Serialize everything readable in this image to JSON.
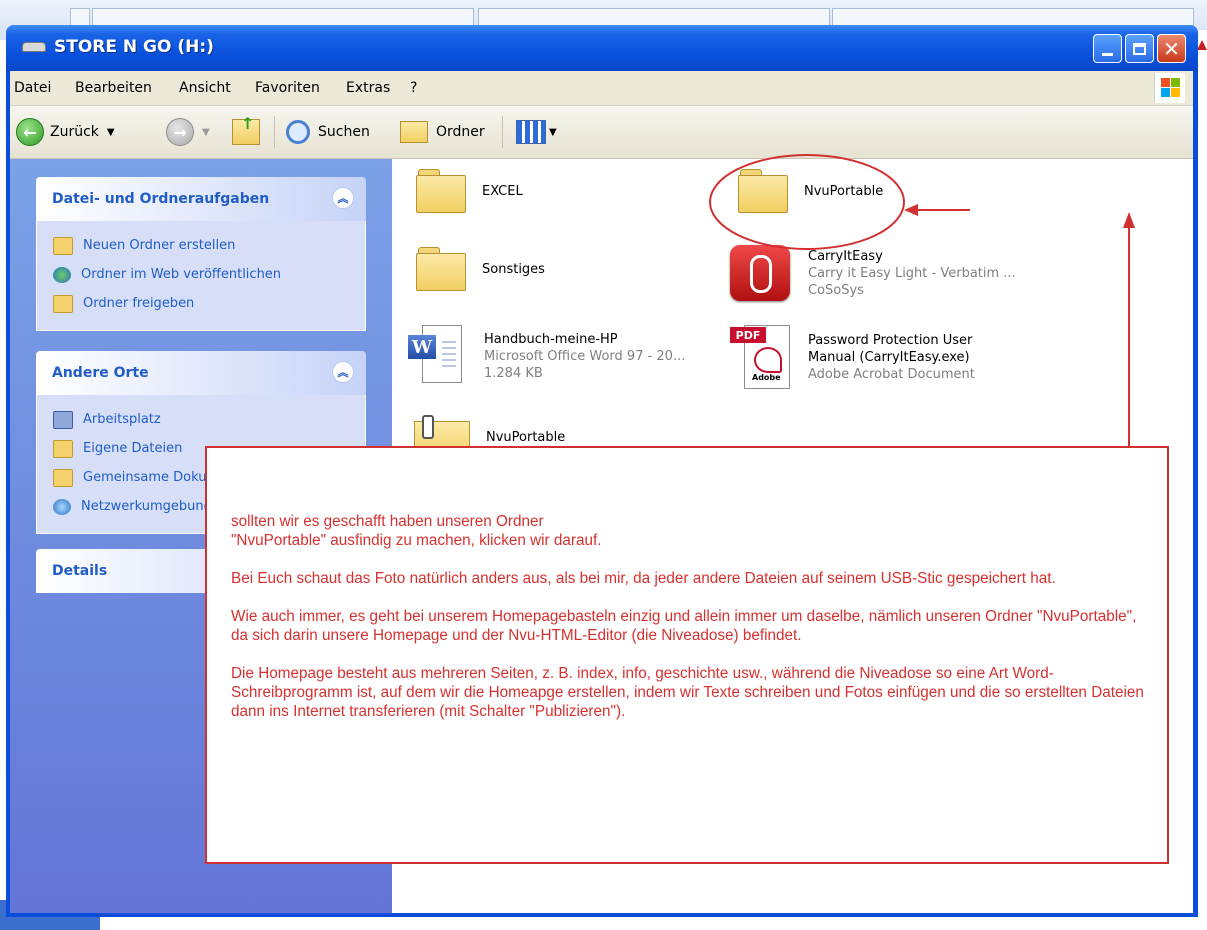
{
  "window": {
    "title": "STORE N GO (H:)"
  },
  "menubar": {
    "items": [
      "Datei",
      "Bearbeiten",
      "Ansicht",
      "Favoriten",
      "Extras",
      "?"
    ]
  },
  "toolbar": {
    "back_label": "Zurück",
    "search_label": "Suchen",
    "folders_label": "Ordner"
  },
  "taskpane": {
    "file_tasks": {
      "title": "Datei- und Ordneraufgaben",
      "items": [
        {
          "label": "Neuen Ordner erstellen",
          "icon": "new-folder-icon"
        },
        {
          "label": "Ordner im Web veröffentlichen",
          "icon": "globe-icon"
        },
        {
          "label": "Ordner freigeben",
          "icon": "share-folder-icon"
        }
      ]
    },
    "other_places": {
      "title": "Andere Orte",
      "items": [
        {
          "label": "Arbeitsplatz",
          "icon": "computer-icon"
        },
        {
          "label": "Eigene Dateien",
          "icon": "documents-folder-icon"
        },
        {
          "label": "Gemeinsame Dokumente",
          "icon": "shared-folder-icon"
        },
        {
          "label": "Netzwerkumgebung",
          "icon": "network-icon"
        }
      ]
    },
    "details": {
      "title": "Details"
    }
  },
  "files": [
    {
      "name": "EXCEL",
      "type": "folder"
    },
    {
      "name": "NvuPortable",
      "type": "folder"
    },
    {
      "name": "Sonstiges",
      "type": "folder"
    },
    {
      "name": "CarryItEasy",
      "line2": "Carry it Easy Light - Verbatim ...",
      "line3": "CoSoSys",
      "type": "app"
    },
    {
      "name": "Handbuch-meine-HP",
      "line2": "Microsoft Office Word 97 - 20...",
      "line3": "1.284 KB",
      "type": "word"
    },
    {
      "name": "Password Protection User",
      "line2": "Manual (CarryItEasy.exe)",
      "line3": "Adobe Acrobat Document",
      "type": "pdf"
    },
    {
      "name": "NvuPortable",
      "type": "zip-folder"
    }
  ],
  "pdf_icon_label": "PDF",
  "adobe_label": "Adobe",
  "annotation": {
    "paragraphs": [
      "sollten wir es geschafft haben unseren Ordner\n\"NvuPortable\" ausfindig zu machen, klicken wir darauf.",
      "Bei Euch schaut das Foto natürlich anders aus, als bei mir, da jeder andere Dateien auf seinem USB-Stic gespeichert hat.",
      "Wie auch immer, es geht bei unserem Homepagebasteln einzig und allein immer um daselbe, nämlich unseren Ordner \"NvuPortable\", da sich darin unsere Homepage und der Nvu-HTML-Editor (die Niveadose) befindet.",
      "Die Homepage besteht aus mehreren Seiten, z. B. index, info, geschichte usw., während die Niveadose so eine Art Word-Schreibprogramm ist, auf dem wir die Homeapge erstellen, indem wir Texte schreiben und Fotos einfügen und die so erstellten Dateien dann ins Internet transferieren (mit Schalter \"Publizieren\")."
    ],
    "color": "#d73030"
  },
  "colors": {
    "title_bar": "#0b52dd",
    "task_pane": "#6f8ddf",
    "task_link": "#215dc6",
    "annotation_red": "#d03030"
  }
}
